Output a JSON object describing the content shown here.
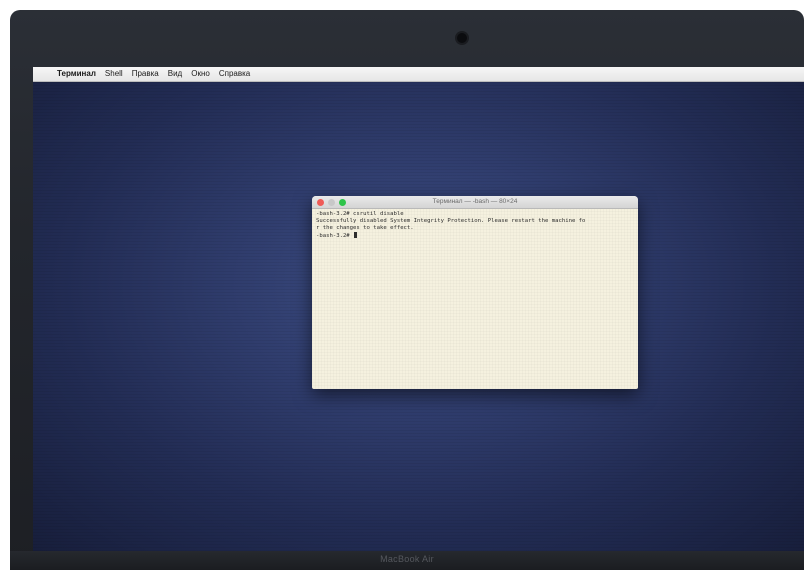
{
  "menubar": {
    "apple_icon": "apple-logo-icon",
    "items": [
      {
        "label": "Терминал"
      },
      {
        "label": "Shell"
      },
      {
        "label": "Правка"
      },
      {
        "label": "Вид"
      },
      {
        "label": "Окно"
      },
      {
        "label": "Справка"
      }
    ]
  },
  "terminal": {
    "title": "Терминал — -bash — 80×24",
    "lines": [
      "-bash-3.2# csrutil disable",
      "Successfully disabled System Integrity Protection. Please restart the machine fo",
      "r the changes to take effect.",
      "-bash-3.2# "
    ],
    "traffic_colors": {
      "close": "#ef5b57",
      "minimize": "#c8c8c8",
      "maximize": "#2ec449"
    }
  },
  "device": {
    "brand": "MacBook Air"
  },
  "colors": {
    "desktop": "#2f3c6c",
    "terminal_bg": "#f5f1df"
  }
}
